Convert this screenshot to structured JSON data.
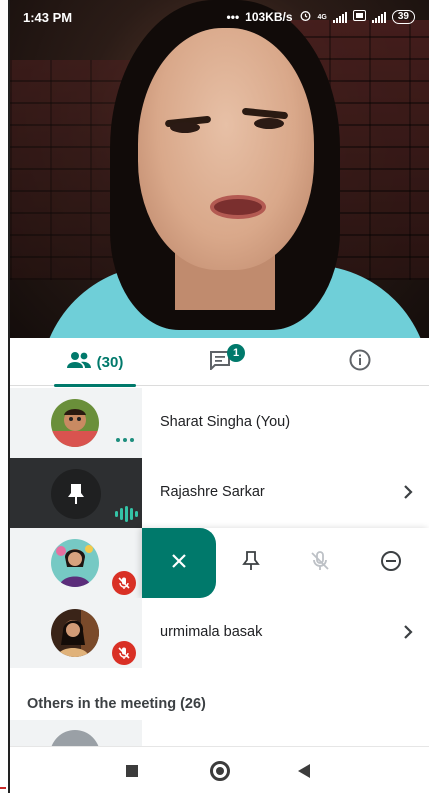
{
  "status_bar": {
    "time": "1:43 PM",
    "speed": "103KB/s",
    "network_label": "4G",
    "battery": "39"
  },
  "tabs": {
    "people_count": "(30)",
    "chat_badge": "1"
  },
  "participants": [
    {
      "name": "Sharat Singha (You)"
    },
    {
      "name": "Rajashre Sarkar"
    },
    {
      "name": ""
    },
    {
      "name": "urmimala basak"
    }
  ],
  "section": {
    "others_label": "Others in the meeting (26)"
  },
  "colors": {
    "accent": "#00796b",
    "mute_red": "#d93025",
    "audio_green": "#34c3a6"
  }
}
